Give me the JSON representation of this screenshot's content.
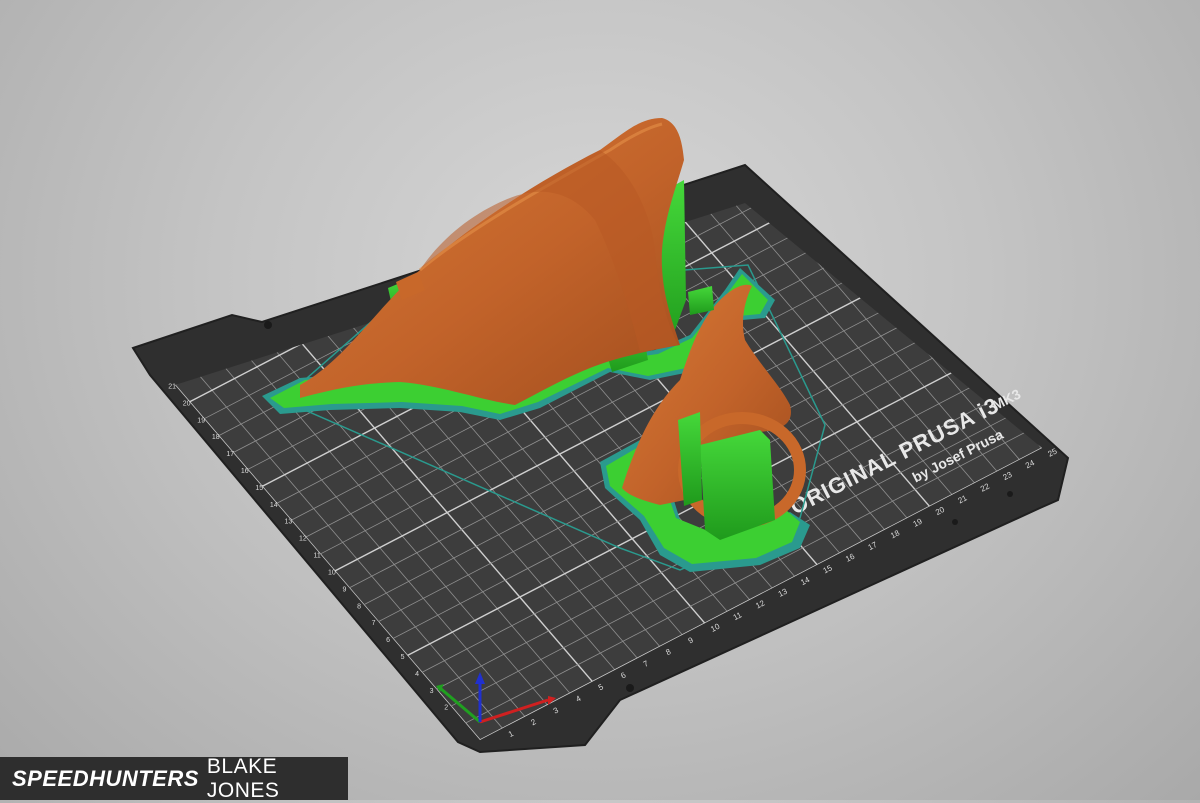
{
  "bed": {
    "brand_line": "ORIGINAL PRUSA i3",
    "model": "MK3",
    "byline": "by Josef Prusa",
    "numbers_front": [
      "1",
      "2",
      "3",
      "4",
      "5",
      "6",
      "7",
      "8",
      "9",
      "10",
      "11",
      "12",
      "13",
      "14",
      "15",
      "16",
      "17",
      "18",
      "19",
      "20",
      "21",
      "22",
      "23",
      "24",
      "25"
    ],
    "numbers_left": [
      "2",
      "3",
      "4",
      "5",
      "6",
      "7",
      "8",
      "9",
      "10",
      "11",
      "12",
      "13",
      "14",
      "15",
      "16",
      "17",
      "18",
      "19",
      "20",
      "21"
    ]
  },
  "watermark": {
    "brand": "SPEEDHUNTERS",
    "author": "BLAKE JONES"
  },
  "colors": {
    "background": "#c4c4c4",
    "bed_sheet": "#3a3a3a",
    "grid_line": "#b8b8b8",
    "part_orange": "#c8682a",
    "support_green": "#2ec02a",
    "skirt_teal": "#2a9a8e",
    "axis_x": "#d02020",
    "axis_y": "#20a020",
    "axis_z": "#2030d0"
  }
}
